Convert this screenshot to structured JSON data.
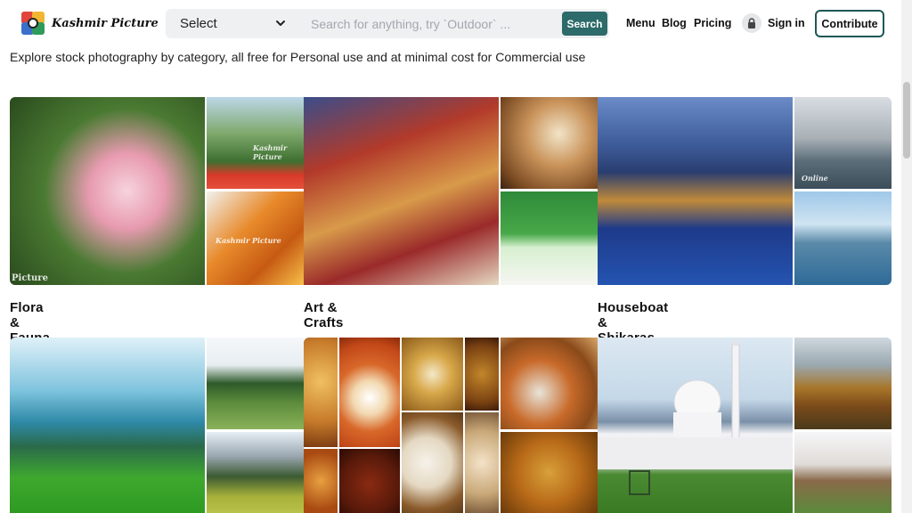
{
  "header": {
    "logo_text": "Kashmir Picture",
    "select_value": "Select",
    "search_placeholder": "Search for anything, try `Outdoor` ...",
    "search_button": "Search",
    "nav": {
      "menu": "Menu",
      "blog": "Blog",
      "pricing": "Pricing",
      "sign_in": "Sign in",
      "contribute": "Contribute"
    }
  },
  "intro": {
    "subtitle": "Explore stock photography by category, all free for Personal use and at minimal cost for Commercial use"
  },
  "categories": [
    {
      "label": "Flora & Fauna"
    },
    {
      "label": "Art & Crafts"
    },
    {
      "label": "Houseboat & Shikaras"
    },
    {
      "label": ""
    },
    {
      "label": ""
    },
    {
      "label": ""
    }
  ],
  "watermarks": {
    "picture": "Picture",
    "kashmir_picture": "Kashmir Picture",
    "online": "Online"
  },
  "colors": {
    "accent": "#2d6a6a",
    "contribute_border": "#1f5757"
  }
}
